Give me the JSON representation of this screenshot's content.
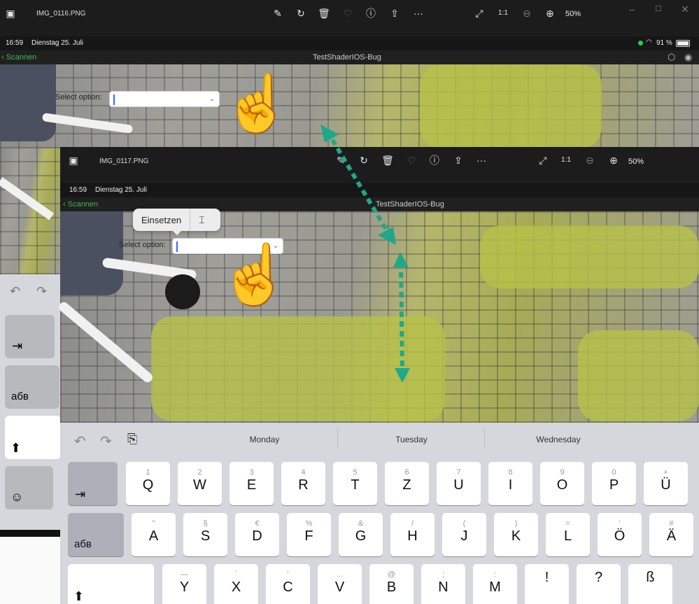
{
  "viewer_back": {
    "filename": "IMG_0116.PNG",
    "zoom": "50%"
  },
  "viewer_front": {
    "filename": "IMG_0117.PNG",
    "zoom": "50%"
  },
  "ipad": {
    "time": "16:59",
    "date": "Dienstag 25. Juli",
    "battery": "91 %",
    "back_label": "Scannen",
    "app_title": "TestShaderIOS-Bug",
    "select_label": "Select option:"
  },
  "context_menu": {
    "paste_label": "Einsetzen"
  },
  "keyboard": {
    "suggestions": [
      "Monday",
      "Tuesday",
      "Wednesday"
    ],
    "side_labels": {
      "cyr": "абв"
    },
    "row1": [
      {
        "main": "Q",
        "sub": "1"
      },
      {
        "main": "W",
        "sub": "2"
      },
      {
        "main": "E",
        "sub": "3"
      },
      {
        "main": "R",
        "sub": "4"
      },
      {
        "main": "T",
        "sub": "5"
      },
      {
        "main": "Z",
        "sub": "6"
      },
      {
        "main": "U",
        "sub": "7"
      },
      {
        "main": "I",
        "sub": "8"
      },
      {
        "main": "O",
        "sub": "9"
      },
      {
        "main": "P",
        "sub": "0"
      },
      {
        "main": "Ü",
        "sub": "+"
      }
    ],
    "row2": [
      {
        "main": "A",
        "sub": "\""
      },
      {
        "main": "S",
        "sub": "§"
      },
      {
        "main": "D",
        "sub": "€"
      },
      {
        "main": "F",
        "sub": "%"
      },
      {
        "main": "G",
        "sub": "&"
      },
      {
        "main": "H",
        "sub": "/"
      },
      {
        "main": "J",
        "sub": "("
      },
      {
        "main": "K",
        "sub": ")"
      },
      {
        "main": "L",
        "sub": "="
      },
      {
        "main": "Ö",
        "sub": "'"
      },
      {
        "main": "Ä",
        "sub": "#"
      }
    ],
    "row3": [
      {
        "main": "Y",
        "sub": "—"
      },
      {
        "main": "X",
        "sub": "`"
      },
      {
        "main": "C",
        "sub": "'"
      },
      {
        "main": "V",
        "sub": "..."
      },
      {
        "main": "B",
        "sub": "@"
      },
      {
        "main": "N",
        "sub": ";"
      },
      {
        "main": "M",
        "sub": ":"
      },
      {
        "main": "!",
        "sub": ""
      },
      {
        "main": "?",
        "sub": ""
      },
      {
        "main": "ß",
        "sub": ""
      }
    ]
  },
  "colors": {
    "accent_green": "#1fa88a",
    "caret_blue": "#2f6bff",
    "back_green": "#3dbb4a"
  }
}
